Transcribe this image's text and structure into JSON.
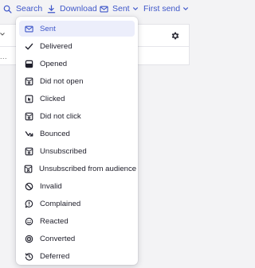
{
  "toolbar": {
    "search_label": "Search",
    "search_icon": "search-icon",
    "download_label": "Download",
    "download_icon": "download-icon",
    "status_filter_label": "Sent",
    "status_filter_icon": "mail-icon",
    "sort_label": "First send",
    "accent_color": "#3f57c9"
  },
  "table": {
    "settings_icon": "gear-icon",
    "row_marker": "..."
  },
  "status_menu": {
    "selected": "Sent",
    "items": [
      {
        "label": "Sent",
        "icon": "mail-icon"
      },
      {
        "label": "Delivered",
        "icon": "check-icon"
      },
      {
        "label": "Opened",
        "icon": "opened-mail-icon"
      },
      {
        "label": "Did not open",
        "icon": "mail-x-icon"
      },
      {
        "label": "Clicked",
        "icon": "cursor-click-icon"
      },
      {
        "label": "Did not click",
        "icon": "mail-x-icon"
      },
      {
        "label": "Bounced",
        "icon": "bounce-arrow-icon"
      },
      {
        "label": "Unsubscribed",
        "icon": "mail-x-icon"
      },
      {
        "label": "Unsubscribed from audience",
        "icon": "mail-x-icon"
      },
      {
        "label": "Invalid",
        "icon": "prohibited-icon"
      },
      {
        "label": "Complained",
        "icon": "speech-bubble-icon"
      },
      {
        "label": "Reacted",
        "icon": "smiley-icon"
      },
      {
        "label": "Converted",
        "icon": "target-icon"
      },
      {
        "label": "Deferred",
        "icon": "history-clock-icon"
      }
    ],
    "highlight_color": "#eceefb"
  }
}
